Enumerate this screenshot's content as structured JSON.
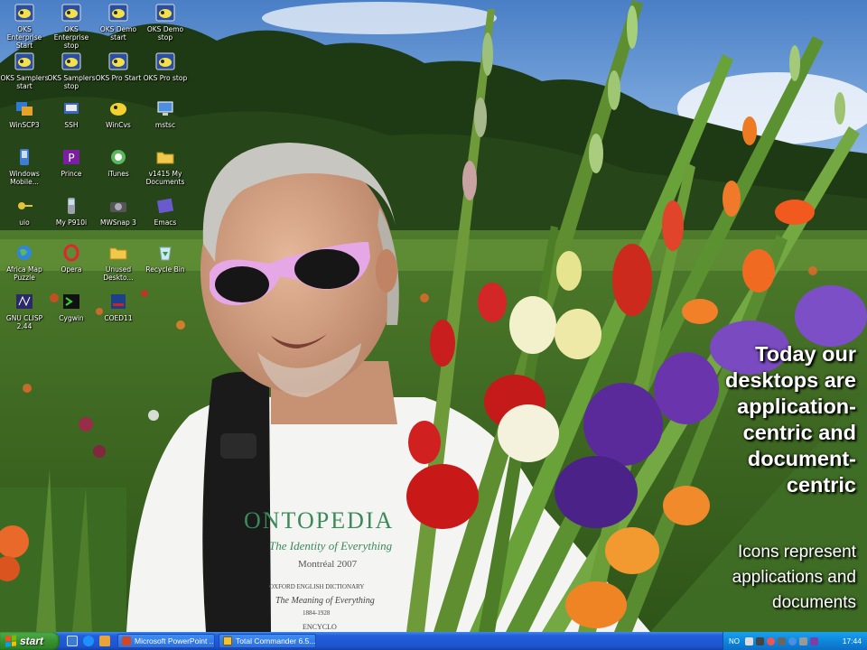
{
  "desktop": {
    "icons": [
      {
        "label": "OKS Enterprise Start",
        "icon": "oks-app-icon"
      },
      {
        "label": "OKS Enterprise stop",
        "icon": "oks-app-icon"
      },
      {
        "label": "OKS Demo start",
        "icon": "oks-app-icon"
      },
      {
        "label": "OKS Demo stop",
        "icon": "oks-app-icon"
      },
      {
        "label": "OKS Samplers start",
        "icon": "oks-app-icon"
      },
      {
        "label": "OKS Samplers stop",
        "icon": "oks-app-icon"
      },
      {
        "label": "OKS Pro Start",
        "icon": "oks-app-icon"
      },
      {
        "label": "OKS Pro stop",
        "icon": "oks-app-icon"
      },
      {
        "label": "WinSCP3",
        "icon": "winscp-icon"
      },
      {
        "label": "SSH",
        "icon": "ssh-icon"
      },
      {
        "label": "WinCvs",
        "icon": "wincvs-icon"
      },
      {
        "label": "mstsc",
        "icon": "remote-desktop-icon"
      },
      {
        "label": "Windows Mobile...",
        "icon": "windows-mobile-icon"
      },
      {
        "label": "Prince",
        "icon": "prince-icon"
      },
      {
        "label": "iTunes",
        "icon": "itunes-icon"
      },
      {
        "label": "v1415 My Documents",
        "icon": "folder-icon"
      },
      {
        "label": "uio",
        "icon": "key-icon"
      },
      {
        "label": "My P910i",
        "icon": "phone-icon"
      },
      {
        "label": "MWSnap 3",
        "icon": "camera-icon"
      },
      {
        "label": "Emacs",
        "icon": "emacs-icon"
      },
      {
        "label": "Africa Map Puzzle",
        "icon": "globe-icon"
      },
      {
        "label": "Opera",
        "icon": "opera-icon"
      },
      {
        "label": "Unused Deskto...",
        "icon": "folder-icon"
      },
      {
        "label": "Recycle Bin",
        "icon": "recycle-bin-icon"
      },
      {
        "label": "GNU CLISP 2.44",
        "icon": "clisp-icon"
      },
      {
        "label": "Cygwin",
        "icon": "cygwin-icon"
      },
      {
        "label": "COED11",
        "icon": "dictionary-icon"
      }
    ]
  },
  "overlay": {
    "headline_lines": [
      "Today our",
      "desktops are",
      "application-",
      "centric and",
      "document-",
      "centric"
    ],
    "sub_lines": [
      "Icons represent",
      "applications and",
      "documents"
    ]
  },
  "photo": {
    "shirt_title": "ONTOPEDIA",
    "shirt_subtitle": "The Identity of Everything",
    "shirt_place": "Montréal 2007",
    "shirt_line1": "OXFORD ENGLISH DICTIONARY",
    "shirt_line2": "The Meaning of Everything",
    "shirt_line3": "1884-1928",
    "shirt_line4": "ENCYCLO"
  },
  "taskbar": {
    "start_label": "start",
    "tasks": [
      {
        "label": "Microsoft PowerPoint ...",
        "icon": "powerpoint-icon"
      },
      {
        "label": "Total Commander 6.5...",
        "icon": "total-commander-icon"
      }
    ],
    "tray_lang": "NO",
    "clock": "17:44"
  },
  "colors": {
    "taskbar_blue": "#245edb",
    "start_green": "#389230",
    "tray_blue": "#0f86da"
  }
}
